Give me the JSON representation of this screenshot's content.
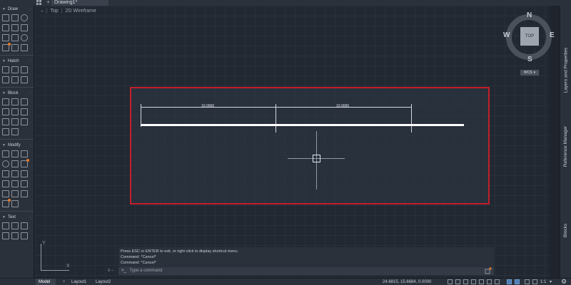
{
  "app": {
    "tab_title": "Drawing1*",
    "new_tab_icon": "plus-icon"
  },
  "view": {
    "close": "–",
    "viewport": "Top",
    "visual_style": "2D Wireframe"
  },
  "palette": {
    "sections": [
      {
        "label": "Draw",
        "rows": 5
      },
      {
        "label": "Hatch",
        "rows": 2
      },
      {
        "label": "Block",
        "rows": 4
      },
      {
        "label": "Modify",
        "rows": 6
      },
      {
        "label": "Text",
        "rows": 2
      }
    ],
    "accent": "#e5792a"
  },
  "drawing": {
    "dim_left": "10.0000",
    "dim_right": "10.0000",
    "highlight_color": "#c21f2a"
  },
  "viewcube": {
    "north": "N",
    "south": "S",
    "east": "E",
    "west": "W",
    "top": "TOP",
    "wcs": "WCS"
  },
  "right_panel": {
    "tab1": "Layers and Properties",
    "tab2": "Reference Manager",
    "tab3": "Blocks"
  },
  "ucs": {
    "y": "Y",
    "x": "X"
  },
  "command": {
    "history": [
      "Press ESC or ENTER to exit, or right-click to display shortcut menu.",
      "Command: *Cancel*",
      "Command: *Cancel*"
    ],
    "prompt": ">_",
    "placeholder": "Type a command",
    "left_label": "≡ –"
  },
  "status": {
    "model": "Model",
    "add_layout": "+",
    "layout1": "Layout1",
    "layout2": "Layout2",
    "coords": "24.6815, 15.6684, 0.0000",
    "scale": "1:1"
  }
}
